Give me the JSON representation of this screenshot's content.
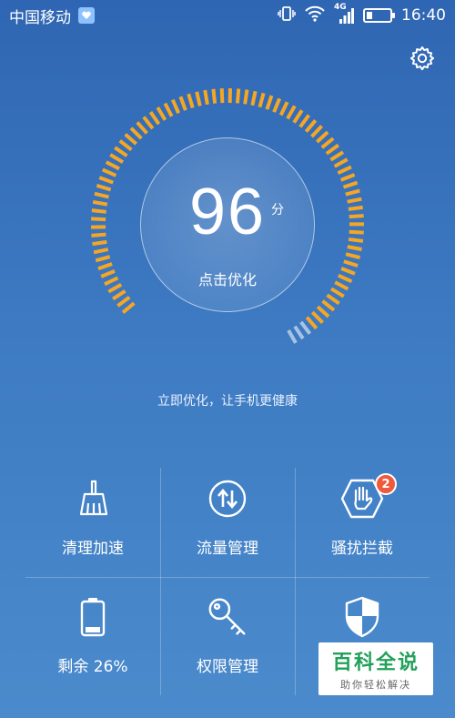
{
  "status_bar": {
    "carrier": "中国移动",
    "network": "4G",
    "time": "16:40",
    "battery_level": 0.26
  },
  "optimizer": {
    "score": "96",
    "score_unit": "分",
    "action": "点击优化",
    "progress": 0.96,
    "tagline": "立即优化，让手机更健康"
  },
  "tiles": [
    {
      "label": "清理加速",
      "icon": "broom-icon"
    },
    {
      "label": "流量管理",
      "icon": "data-arrows-icon"
    },
    {
      "label": "骚扰拦截",
      "icon": "hand-block-icon",
      "badge": "2"
    },
    {
      "label": "剩余 26%",
      "icon": "battery-icon"
    },
    {
      "label": "权限管理",
      "icon": "key-icon"
    },
    {
      "label": "",
      "icon": "shield-icon"
    }
  ],
  "watermark": {
    "main": "百科全说",
    "sub": "助你轻松解决"
  },
  "colors": {
    "accent": "#f5a623",
    "background": "#3b74bd",
    "badge": "#f05a3c"
  }
}
